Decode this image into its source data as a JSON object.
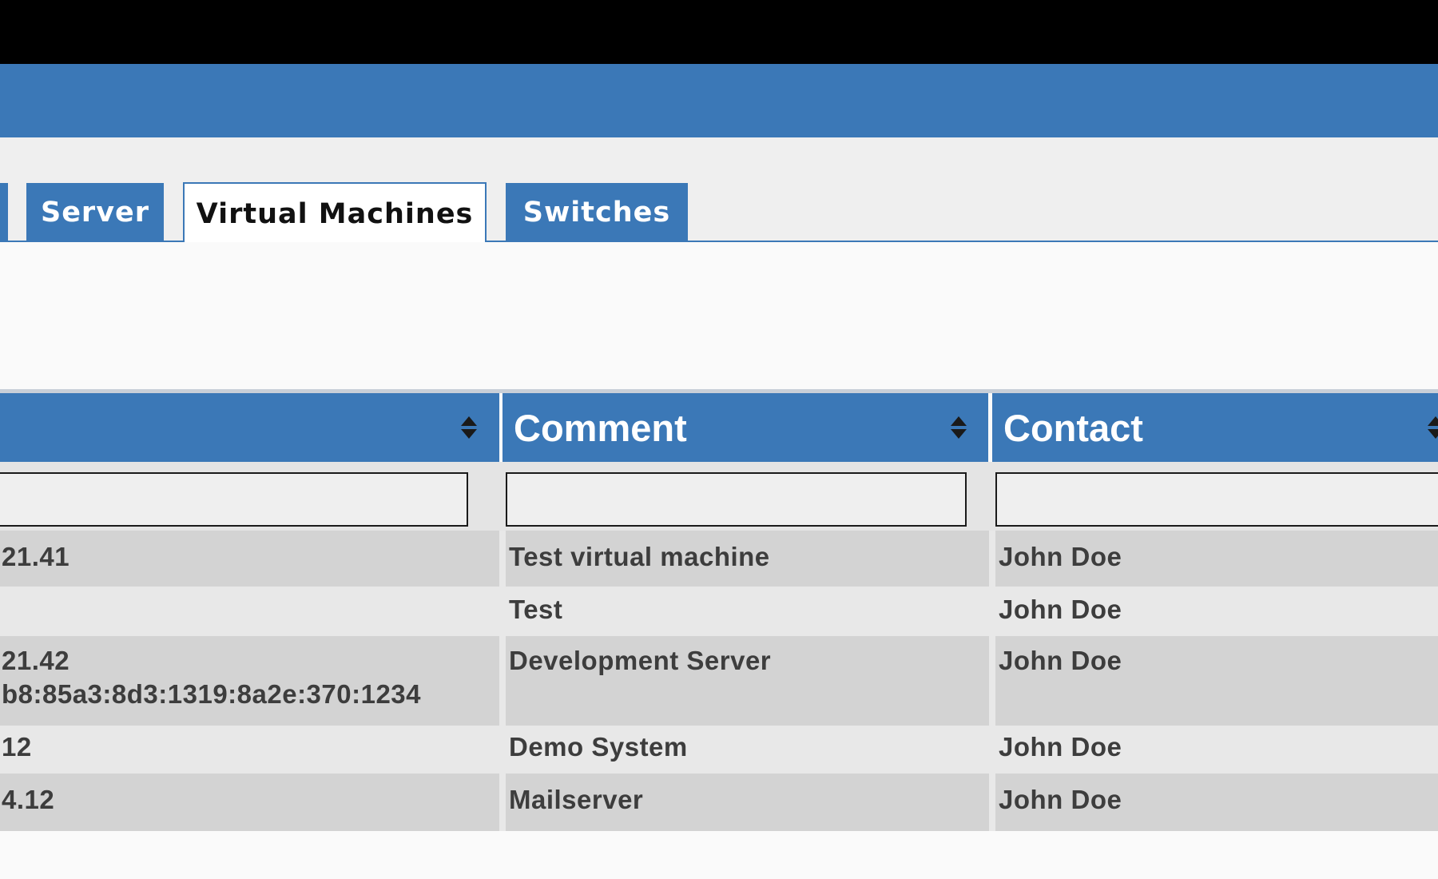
{
  "tabs": [
    {
      "label": "Server"
    },
    {
      "label": "Virtual Machines"
    },
    {
      "label": "Switches"
    }
  ],
  "table": {
    "columns": [
      {
        "label": ""
      },
      {
        "label": "Comment"
      },
      {
        "label": "Contact"
      }
    ],
    "rows": [
      {
        "address_line1": "21.41",
        "address_line2": "",
        "comment": "Test virtual machine",
        "contact": "John Doe"
      },
      {
        "address_line1": "",
        "address_line2": "",
        "comment": "Test",
        "contact": "John Doe"
      },
      {
        "address_line1": "21.42",
        "address_line2": "b8:85a3:8d3:1319:8a2e:370:1234",
        "comment": "Development Server",
        "contact": "John Doe"
      },
      {
        "address_line1": "12",
        "address_line2": "",
        "comment": "Demo System",
        "contact": "John Doe"
      },
      {
        "address_line1": "4.12",
        "address_line2": "",
        "comment": "Mailserver",
        "contact": "John Doe"
      }
    ]
  },
  "colors": {
    "accent": "#3b78b7",
    "row_dark": "#d3d3d3",
    "row_light": "#e8e8e8"
  }
}
